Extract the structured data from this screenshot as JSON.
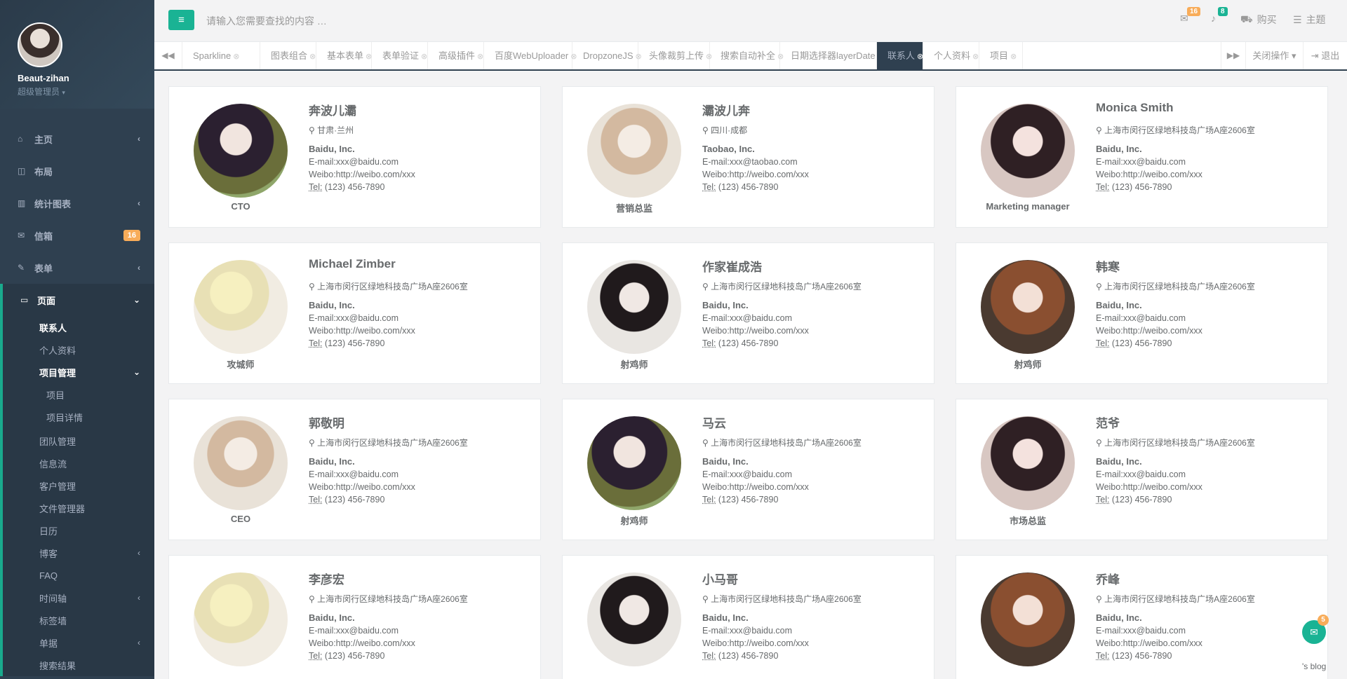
{
  "profile": {
    "name": "Beaut-zihan",
    "role": "超级管理员"
  },
  "nav": {
    "home": "主页",
    "layout": "布局",
    "charts": "统计图表",
    "mail": "信箱",
    "mail_badge": "16",
    "forms": "表单",
    "pages": "页面",
    "contacts": "联系人",
    "profile_page": "个人资料",
    "project_mgmt": "项目管理",
    "project": "项目",
    "project_detail": "项目详情",
    "team": "团队管理",
    "feed": "信息流",
    "clients": "客户管理",
    "files": "文件管理器",
    "calendar": "日历",
    "blog": "博客",
    "faq": "FAQ",
    "timeline": "时间轴",
    "tag_wall": "标签墙",
    "invoice": "单据",
    "search_results": "搜索结果"
  },
  "topbar": {
    "search_placeholder": "请输入您需要查找的内容 …",
    "mail_count": "16",
    "alert_count": "8",
    "buy": "购买",
    "theme": "主题"
  },
  "tabs": {
    "items": [
      "Sparkline",
      "图表组合",
      "基本表单",
      "表单验证",
      "高级插件",
      "百度WebUploader",
      "DropzoneJS",
      "头像裁剪上传",
      "搜索自动补全",
      "日期选择器layerDate",
      "联系人",
      "个人资料",
      "项目"
    ],
    "close_ops": "关闭操作",
    "logout": "退出"
  },
  "contacts": [
    {
      "name": "奔波儿灞",
      "location": "甘肃·兰州",
      "company": "Baidu, Inc.",
      "email": "E-mail:xxx@baidu.com",
      "weibo": "Weibo:http://weibo.com/xxx",
      "tel_label": "Tel:",
      "tel": " (123) 456-7890",
      "role": "CTO"
    },
    {
      "name": "灞波儿奔",
      "location": "四川·成都",
      "company": "Taobao, Inc.",
      "email": "E-mail:xxx@taobao.com",
      "weibo": "Weibo:http://weibo.com/xxx",
      "tel_label": "Tel:",
      "tel": " (123) 456-7890",
      "role": "营销总监"
    },
    {
      "name": "Monica Smith",
      "location": "上海市闵行区绿地科技岛广场A座2606室",
      "company": "Baidu, Inc.",
      "email": "E-mail:xxx@baidu.com",
      "weibo": "Weibo:http://weibo.com/xxx",
      "tel_label": "Tel:",
      "tel": " (123) 456-7890",
      "role": "Marketing manager"
    },
    {
      "name": "Michael Zimber",
      "location": "上海市闵行区绿地科技岛广场A座2606室",
      "company": "Baidu, Inc.",
      "email": "E-mail:xxx@baidu.com",
      "weibo": "Weibo:http://weibo.com/xxx",
      "tel_label": "Tel:",
      "tel": " (123) 456-7890",
      "role": "攻城师"
    },
    {
      "name": "作家崔成浩",
      "location": "上海市闵行区绿地科技岛广场A座2606室",
      "company": "Baidu, Inc.",
      "email": "E-mail:xxx@baidu.com",
      "weibo": "Weibo:http://weibo.com/xxx",
      "tel_label": "Tel:",
      "tel": " (123) 456-7890",
      "role": "射鸡师"
    },
    {
      "name": "韩寒",
      "location": "上海市闵行区绿地科技岛广场A座2606室",
      "company": "Baidu, Inc.",
      "email": "E-mail:xxx@baidu.com",
      "weibo": "Weibo:http://weibo.com/xxx",
      "tel_label": "Tel:",
      "tel": " (123) 456-7890",
      "role": "射鸡师"
    },
    {
      "name": "郭敬明",
      "location": "上海市闵行区绿地科技岛广场A座2606室",
      "company": "Baidu, Inc.",
      "email": "E-mail:xxx@baidu.com",
      "weibo": "Weibo:http://weibo.com/xxx",
      "tel_label": "Tel:",
      "tel": " (123) 456-7890",
      "role": "CEO"
    },
    {
      "name": "马云",
      "location": "上海市闵行区绿地科技岛广场A座2606室",
      "company": "Baidu, Inc.",
      "email": "E-mail:xxx@baidu.com",
      "weibo": "Weibo:http://weibo.com/xxx",
      "tel_label": "Tel:",
      "tel": " (123) 456-7890",
      "role": "射鸡师"
    },
    {
      "name": "范爷",
      "location": "上海市闵行区绿地科技岛广场A座2606室",
      "company": "Baidu, Inc.",
      "email": "E-mail:xxx@baidu.com",
      "weibo": "Weibo:http://weibo.com/xxx",
      "tel_label": "Tel:",
      "tel": " (123) 456-7890",
      "role": "市场总监"
    },
    {
      "name": "李彦宏",
      "location": "上海市闵行区绿地科技岛广场A座2606室",
      "company": "Baidu, Inc.",
      "email": "E-mail:xxx@baidu.com",
      "weibo": "Weibo:http://weibo.com/xxx",
      "tel_label": "Tel:",
      "tel": " (123) 456-7890",
      "role": ""
    },
    {
      "name": "小马哥",
      "location": "上海市闵行区绿地科技岛广场A座2606室",
      "company": "Baidu, Inc.",
      "email": "E-mail:xxx@baidu.com",
      "weibo": "Weibo:http://weibo.com/xxx",
      "tel_label": "Tel:",
      "tel": " (123) 456-7890",
      "role": ""
    },
    {
      "name": "乔峰",
      "location": "上海市闵行区绿地科技岛广场A座2606室",
      "company": "Baidu, Inc.",
      "email": "E-mail:xxx@baidu.com",
      "weibo": "Weibo:http://weibo.com/xxx",
      "tel_label": "Tel:",
      "tel": " (123) 456-7890",
      "role": ""
    }
  ],
  "chat": {
    "count": "5"
  },
  "footer": {
    "blog": "'s blog"
  },
  "icons": [
    "home-icon",
    "layout-icon",
    "chart-icon",
    "mail-icon",
    "form-icon",
    "page-icon",
    "menu-icon",
    "bell-icon",
    "cart-icon",
    "theme-icon",
    "location-icon",
    "chat-icon",
    "logout-icon"
  ],
  "colors": {
    "accent": "#1ab394",
    "sidebar": "#2f4050",
    "badge": "#f8ac59"
  }
}
